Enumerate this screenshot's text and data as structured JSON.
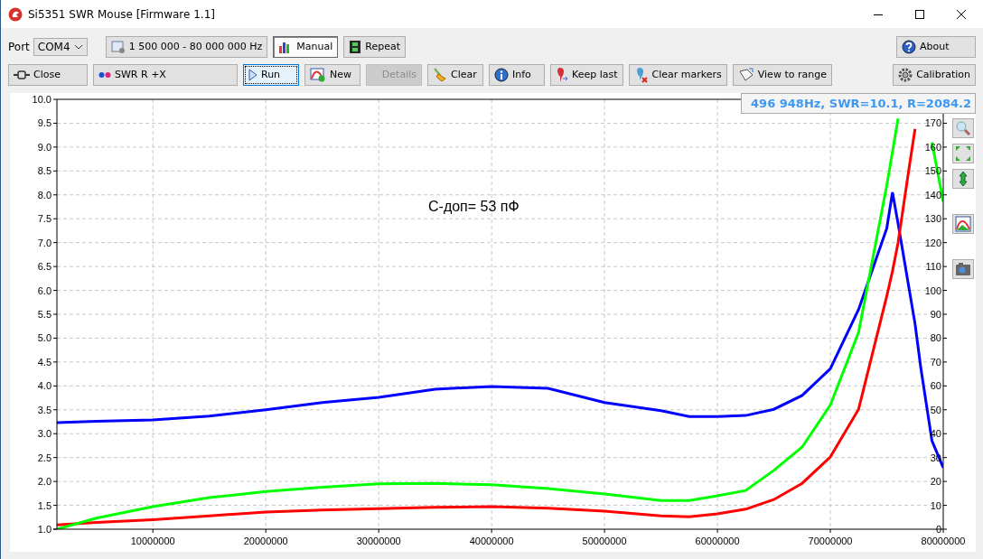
{
  "window": {
    "title": "Si5351 SWR Mouse [Firmware 1.1]"
  },
  "port": {
    "label": "Port",
    "value": "COM4"
  },
  "toolbar_row1": [
    {
      "label": "1 500 000 - 80 000 000 Hz",
      "selected": false,
      "disabled": false,
      "focused": false
    },
    {
      "label": "Manual",
      "selected": true,
      "disabled": false,
      "focused": false
    },
    {
      "label": "Repeat",
      "selected": false,
      "disabled": false,
      "focused": false
    },
    {
      "label": "About",
      "selected": false,
      "disabled": false,
      "focused": false
    }
  ],
  "toolbar_row2": [
    {
      "label": "Close",
      "selected": false,
      "disabled": false,
      "focused": false
    },
    {
      "label": "SWR R +X",
      "selected": false,
      "disabled": false,
      "focused": false
    },
    {
      "label": "Run",
      "selected": false,
      "disabled": false,
      "focused": true
    },
    {
      "label": "New",
      "selected": false,
      "disabled": false,
      "focused": false
    },
    {
      "label": "Details",
      "selected": false,
      "disabled": true,
      "focused": false
    },
    {
      "label": "Clear",
      "selected": false,
      "disabled": false,
      "focused": false
    },
    {
      "label": "Info",
      "selected": false,
      "disabled": false,
      "focused": false
    },
    {
      "label": "Keep last",
      "selected": false,
      "disabled": false,
      "focused": false
    },
    {
      "label": "Clear markers",
      "selected": false,
      "disabled": false,
      "focused": false
    },
    {
      "label": "View to range",
      "selected": false,
      "disabled": false,
      "focused": false
    },
    {
      "label": "Calibration",
      "selected": false,
      "disabled": false,
      "focused": false
    }
  ],
  "cursor_readout": "496 948Hz, SWR=10.1, R=2084.2",
  "right_axis": {
    "ticks": [
      "170",
      "160",
      "150",
      "140",
      "130",
      "120",
      "110",
      "100",
      "90",
      "80",
      "70",
      "60",
      "50",
      "40",
      "30",
      "20",
      "10",
      "0"
    ]
  },
  "chart_data": {
    "type": "line",
    "grid": true,
    "x": [
      1500000,
      5000000,
      10000000,
      15000000,
      20000000,
      25000000,
      30000000,
      35000000,
      40000000,
      45000000,
      50000000,
      55000000,
      57500000,
      60000000,
      62500000,
      65000000,
      67500000,
      70000000,
      72500000,
      75000000,
      75500000,
      76000000,
      77000000,
      77500000,
      78000000,
      79000000,
      80000000
    ],
    "xlim": [
      1500000,
      80000000
    ],
    "ylim": [
      1,
      10
    ],
    "xticks": [
      10000000,
      20000000,
      30000000,
      40000000,
      50000000,
      60000000,
      70000000,
      80000000
    ],
    "yticks": [
      {
        "value": 1,
        "label": "1.0"
      },
      {
        "value": 1.5,
        "label": "1.5"
      },
      {
        "value": 2,
        "label": "2.0"
      },
      {
        "value": 2.5,
        "label": "2.5"
      },
      {
        "value": 3,
        "label": "3.0"
      },
      {
        "value": 3.5,
        "label": "3.5"
      },
      {
        "value": 4,
        "label": "4.0"
      },
      {
        "value": 4.5,
        "label": "4.5"
      },
      {
        "value": 5,
        "label": "5.0"
      },
      {
        "value": 5.5,
        "label": "5.5"
      },
      {
        "value": 6,
        "label": "6.0"
      },
      {
        "value": 6.5,
        "label": "6.5"
      },
      {
        "value": 7,
        "label": "7.0"
      },
      {
        "value": 7.5,
        "label": "7.5"
      },
      {
        "value": 8,
        "label": "8.0"
      },
      {
        "value": 8.5,
        "label": "8.5"
      },
      {
        "value": 9,
        "label": "9.0"
      },
      {
        "value": 9.5,
        "label": "9.5"
      },
      {
        "value": 10,
        "label": "10.0"
      }
    ],
    "series": [
      {
        "color": "#0000ff",
        "values": [
          3.23,
          3.26,
          3.29,
          3.37,
          3.5,
          3.65,
          3.76,
          3.93,
          3.99,
          3.95,
          3.65,
          3.48,
          3.36,
          3.36,
          3.38,
          3.51,
          3.8,
          4.36,
          5.6,
          7.3,
          8.05,
          7.4,
          6.0,
          5.3,
          4.4,
          2.85,
          2.29
        ]
      },
      {
        "color": "#ff0000",
        "values": [
          1.09,
          1.14,
          1.2,
          1.28,
          1.36,
          1.4,
          1.43,
          1.46,
          1.47,
          1.44,
          1.38,
          1.28,
          1.26,
          1.32,
          1.42,
          1.62,
          1.96,
          2.51,
          3.51,
          5.88,
          6.4,
          7.0,
          8.6,
          9.38,
          null,
          null,
          null
        ]
      },
      {
        "color": "#00ff00",
        "values": [
          1.0,
          1.23,
          1.47,
          1.66,
          1.79,
          1.88,
          1.95,
          1.96,
          1.93,
          1.85,
          1.74,
          1.6,
          1.6,
          1.7,
          1.81,
          2.23,
          2.72,
          3.6,
          5.12,
          8.2,
          8.9,
          9.6,
          null,
          null,
          null,
          9.1,
          7.86
        ]
      }
    ],
    "annotations": [
      "С-доп= 53 пФ"
    ]
  }
}
